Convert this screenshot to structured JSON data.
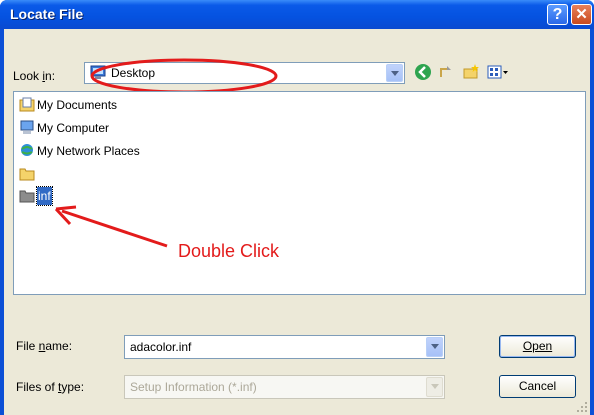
{
  "window": {
    "title": "Locate File"
  },
  "toolbar": {
    "look_in_label": "Look in:",
    "look_in_value": "Desktop"
  },
  "files": [
    {
      "name": "My Documents",
      "icon": "my-documents-icon"
    },
    {
      "name": "My Computer",
      "icon": "my-computer-icon"
    },
    {
      "name": "My Network Places",
      "icon": "network-places-icon"
    },
    {
      "name": "",
      "icon": "folder-icon"
    },
    {
      "name": "inf",
      "icon": "folder-icon",
      "selected": true
    }
  ],
  "annotation": {
    "text": "Double Click",
    "color": "#e31b1b"
  },
  "form": {
    "file_name_label": "File name:",
    "file_name_value": "adacolor.inf",
    "files_of_type_label": "Files of type:",
    "files_of_type_value": "Setup Information (*.inf)",
    "open_label": "Open",
    "cancel_label": "Cancel"
  },
  "colors": {
    "titlebar": "#0552e0",
    "dialog_bg": "#ece9d8",
    "selection": "#316ac5"
  }
}
